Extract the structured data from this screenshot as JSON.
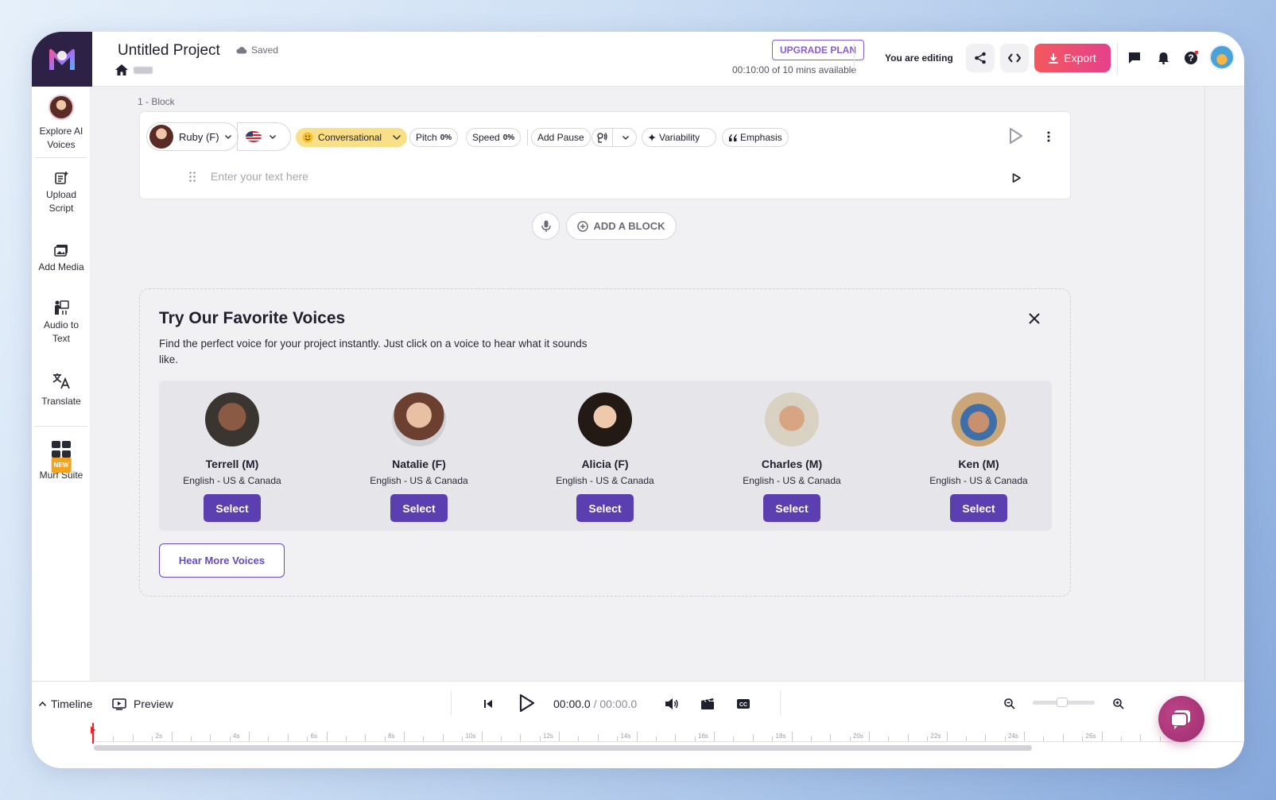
{
  "header": {
    "project_title": "Untitled Project",
    "saved_label": "Saved",
    "upgrade_label": "UPGRADE PLAN",
    "availability": "00:10:00 of 10 mins available",
    "editing_label": "You are editing",
    "export_label": "Export"
  },
  "sidebar": {
    "items": [
      {
        "label1": "Explore AI",
        "label2": "Voices"
      },
      {
        "label1": "Upload",
        "label2": "Script"
      },
      {
        "label1": "Add Media",
        "label2": ""
      },
      {
        "label1": "Audio to",
        "label2": "Text"
      },
      {
        "label1": "Translate",
        "label2": ""
      },
      {
        "label1": "Murf Suite",
        "label2": "",
        "badge": "NEW"
      }
    ]
  },
  "block": {
    "label": "1 -  Block",
    "voice_name": "Ruby (F)",
    "style": "Conversational",
    "pitch_label": "Pitch",
    "pitch_value": "0%",
    "speed_label": "Speed",
    "speed_value": "0%",
    "add_pause": "Add Pause",
    "variability": "Variability",
    "emphasis": "Emphasis",
    "placeholder": "Enter your text here"
  },
  "add_block_label": "ADD A BLOCK",
  "favorites": {
    "title": "Try Our Favorite Voices",
    "description": "Find the perfect voice for your project instantly. Just click on a voice to hear what it sounds like.",
    "voices": [
      {
        "name": "Terrell (M)",
        "lang": "English - US & Canada",
        "select": "Select",
        "photo_color": "#6b4a3a"
      },
      {
        "name": "Natalie (F)",
        "lang": "English - US & Canada",
        "select": "Select",
        "photo_color": "#b98e76"
      },
      {
        "name": "Alicia (F)",
        "lang": "English - US & Canada",
        "select": "Select",
        "photo_color": "#3a2520"
      },
      {
        "name": "Charles (M)",
        "lang": "English - US & Canada",
        "select": "Select",
        "photo_color": "#c9b69a"
      },
      {
        "name": "Ken (M)",
        "lang": "English - US & Canada",
        "select": "Select",
        "photo_color": "#7a6a5a"
      }
    ],
    "hear_more": "Hear More Voices"
  },
  "timeline": {
    "timeline_label": "Timeline",
    "preview_label": "Preview",
    "current_time": "00:00.0",
    "total_time": "00:00.0",
    "ticks": [
      "2s",
      "4s",
      "6s",
      "8s",
      "10s",
      "12s",
      "14s",
      "16s",
      "18s",
      "20s",
      "22s",
      "24s",
      "26s"
    ]
  },
  "colors": {
    "accent": "#5b3fb0",
    "export_gradient_start": "#f2595e",
    "export_gradient_end": "#e6418a",
    "style_pill": "#f9df86"
  }
}
